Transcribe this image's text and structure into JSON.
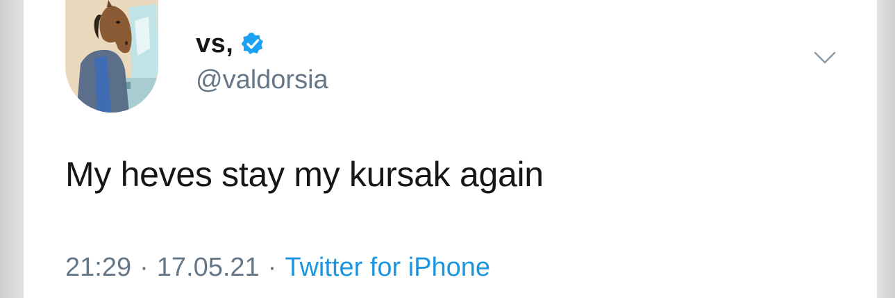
{
  "tweet": {
    "display_name": "vs,",
    "verified": true,
    "handle": "@valdorsia",
    "text": "My heves stay my kursak again",
    "time": "21:29",
    "date": "17.05.21",
    "separator": "·",
    "source": "Twitter for iPhone"
  },
  "icons": {
    "verified": "verified-badge-icon",
    "menu": "chevron-down-icon",
    "avatar": "profile-avatar"
  },
  "colors": {
    "text_primary": "#14171a",
    "text_secondary": "#657786",
    "accent": "#1b95e0",
    "verified_badge": "#1da1f2",
    "background": "#ffffff"
  }
}
